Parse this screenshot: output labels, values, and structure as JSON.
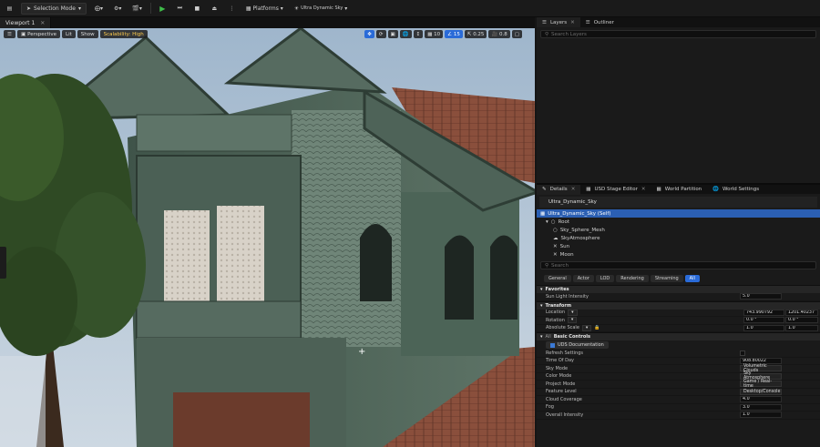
{
  "toolbar": {
    "mode_label": "Selection Mode",
    "platforms_label": "Platforms",
    "sky_label": "Ultra Dynamic Sky"
  },
  "viewport": {
    "tab_label": "Viewport 1",
    "perspective": "Perspective",
    "lit": "Lit",
    "show": "Show",
    "scalability": "Scalability: High",
    "grid_snap": "10",
    "rot_snap": "15",
    "scale_snap": "0.25",
    "cam_speed": "0.8"
  },
  "layers": {
    "tab_layers": "Layers",
    "tab_outliner": "Outliner",
    "search_placeholder": "Search Layers"
  },
  "details": {
    "tabs": [
      "Details",
      "USD Stage Editor",
      "World Partition",
      "World Settings"
    ],
    "actor_name": "Ultra_Dynamic_Sky",
    "tree": [
      {
        "label": "Ultra_Dynamic_Sky (Self)",
        "selected": true,
        "indent": 4
      },
      {
        "label": "Root",
        "selected": false,
        "indent": 10
      },
      {
        "label": "Sky_Sphere_Mesh",
        "selected": false,
        "indent": 18
      },
      {
        "label": "SkyAtmosphere",
        "selected": false,
        "indent": 18
      },
      {
        "label": "Sun",
        "selected": false,
        "indent": 18
      },
      {
        "label": "Moon",
        "selected": false,
        "indent": 18
      }
    ],
    "search_placeholder": "Search",
    "categories": [
      "General",
      "Actor",
      "LOD",
      "Rendering",
      "Streaming",
      "All"
    ],
    "active_category": "All",
    "favorites_label": "Favorites",
    "sun_light_intensity_label": "Sun Light Intensity",
    "sun_light_intensity_value": "5.0",
    "transform_label": "Transform",
    "location_label": "Location",
    "location_x": "743.990792",
    "location_y": "1201.40237",
    "rotation_label": "Rotation",
    "rotation_x": "0.0 °",
    "rotation_y": "0.0 °",
    "scale_label": "Absolute Scale",
    "scale_x": "1.0",
    "scale_y": "1.0",
    "basic_controls_label": "Basic Controls",
    "all_label": "All",
    "uds_doc_label": "UDS Documentation",
    "props": [
      {
        "label": "Refresh Settings",
        "type": "check"
      },
      {
        "label": "Time Of Day",
        "type": "value",
        "value": "908.80022"
      },
      {
        "label": "Sky Mode",
        "type": "dropdown",
        "value": "Volumetric Clouds"
      },
      {
        "label": "Color Mode",
        "type": "dropdown",
        "value": "Sky Atmosphere"
      },
      {
        "label": "Project Mode",
        "type": "dropdown",
        "value": "Game / Real-time"
      },
      {
        "label": "Feature Level",
        "type": "dropdown",
        "value": "Desktop/Console"
      },
      {
        "label": "Cloud Coverage",
        "type": "value",
        "value": "4.0"
      },
      {
        "label": "Fog",
        "type": "value",
        "value": "3.0"
      },
      {
        "label": "Overall Intensity",
        "type": "value",
        "value": "1.0"
      }
    ]
  },
  "colors": {
    "accent": "#2a6bd8",
    "play_green": "#3fbf4a",
    "scalability_yellow": "#ffcc4d"
  }
}
